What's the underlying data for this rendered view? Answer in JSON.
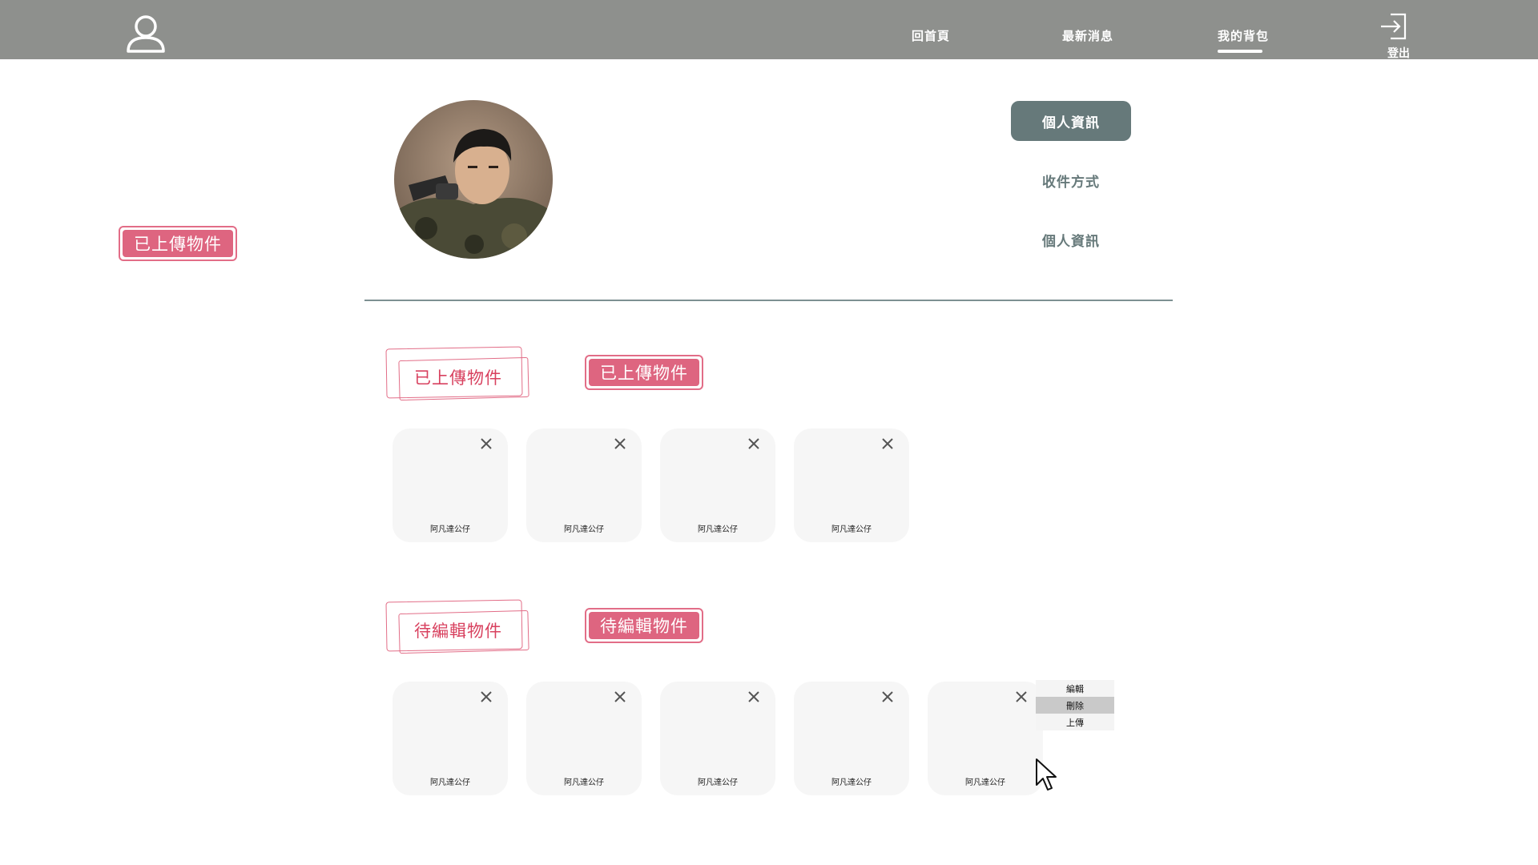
{
  "header": {
    "nav": [
      {
        "label": "回首頁"
      },
      {
        "label": "最新消息"
      },
      {
        "label": "我的背包"
      }
    ],
    "active_nav": "我的背包",
    "logout_label": "登出"
  },
  "left_tag": {
    "label": "已上傳物件"
  },
  "side_menu": [
    {
      "label": "個人資訊",
      "active": true
    },
    {
      "label": "收件方式",
      "active": false
    },
    {
      "label": "個人資訊",
      "active": false
    }
  ],
  "sections": {
    "uploaded": {
      "outline_label": "已上傳物件",
      "filled_label": "已上傳物件",
      "cards": [
        {
          "title": "阿凡達公仔"
        },
        {
          "title": "阿凡達公仔"
        },
        {
          "title": "阿凡達公仔"
        },
        {
          "title": "阿凡達公仔"
        }
      ]
    },
    "pending": {
      "outline_label": "待編輯物件",
      "filled_label": "待編輯物件",
      "cards": [
        {
          "title": "阿凡達公仔"
        },
        {
          "title": "阿凡達公仔"
        },
        {
          "title": "阿凡達公仔"
        },
        {
          "title": "阿凡達公仔"
        },
        {
          "title": "阿凡達公仔"
        }
      ]
    }
  },
  "context_menu": {
    "items": [
      {
        "label": "編輯"
      },
      {
        "label": "刪除"
      },
      {
        "label": "上傳"
      }
    ],
    "hovered": "刪除"
  },
  "colors": {
    "topbar": "#8e908d",
    "accent_pink": "#de6580",
    "slate": "#66797a",
    "card_bg": "#f6f6f6"
  }
}
